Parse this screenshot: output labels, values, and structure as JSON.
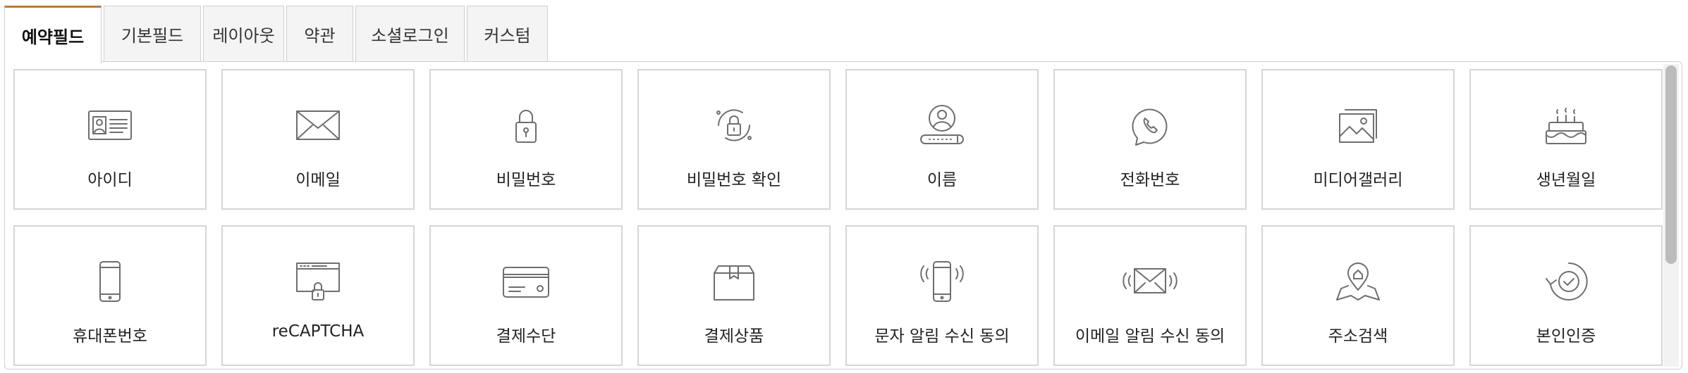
{
  "tabs": [
    {
      "label": "예약필드",
      "active": true
    },
    {
      "label": "기본필드"
    },
    {
      "label": "레이아웃"
    },
    {
      "label": "약관"
    },
    {
      "label": "소셜로그인"
    },
    {
      "label": "커스텀"
    }
  ],
  "fields": [
    {
      "label": "아이디",
      "icon": "id-card-icon"
    },
    {
      "label": "이메일",
      "icon": "envelope-icon"
    },
    {
      "label": "비밀번호",
      "icon": "lock-icon"
    },
    {
      "label": "비밀번호 확인",
      "icon": "lock-refresh-icon"
    },
    {
      "label": "이름",
      "icon": "user-name-icon"
    },
    {
      "label": "전화번호",
      "icon": "phone-call-icon"
    },
    {
      "label": "미디어갤러리",
      "icon": "image-gallery-icon"
    },
    {
      "label": "생년월일",
      "icon": "birthday-cake-icon"
    },
    {
      "label": "휴대폰번호",
      "icon": "mobile-phone-icon"
    },
    {
      "label": "reCAPTCHA",
      "icon": "browser-lock-icon"
    },
    {
      "label": "결제수단",
      "icon": "credit-card-icon"
    },
    {
      "label": "결제상품",
      "icon": "package-box-icon"
    },
    {
      "label": "문자 알림 수신 동의",
      "icon": "vibrating-phone-icon"
    },
    {
      "label": "이메일 알림 수신 동의",
      "icon": "vibrating-envelope-icon"
    },
    {
      "label": "주소검색",
      "icon": "map-pin-icon"
    },
    {
      "label": "본인인증",
      "icon": "verified-refresh-icon"
    }
  ],
  "colors": {
    "accent": "#b87a43",
    "border": "#d6d6d6",
    "icon": "#6e6e6e"
  }
}
